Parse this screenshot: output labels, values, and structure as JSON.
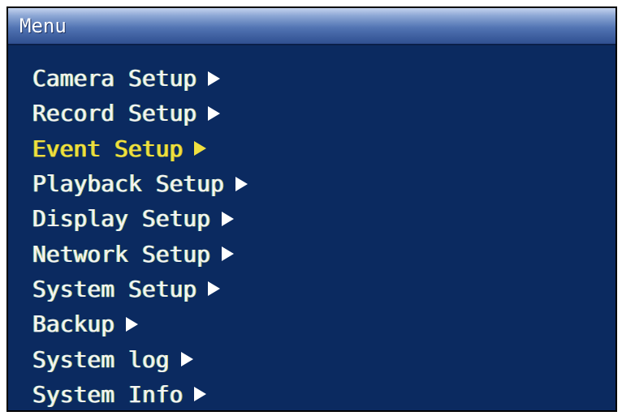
{
  "window": {
    "title": "Menu"
  },
  "menu": {
    "selected_index": 2,
    "items": [
      {
        "label": "Camera Setup"
      },
      {
        "label": "Record Setup"
      },
      {
        "label": "Event Setup"
      },
      {
        "label": "Playback Setup"
      },
      {
        "label": "Display Setup"
      },
      {
        "label": "Network Setup"
      },
      {
        "label": "System Setup"
      },
      {
        "label": "Backup"
      },
      {
        "label": "System log"
      },
      {
        "label": "System Info"
      }
    ]
  },
  "colors": {
    "background": "#0b2a60",
    "text": "#f4f4f4",
    "selected_text": "#f0e040",
    "title_bar": "#5274b3"
  },
  "icons": {
    "submenu_arrow": "triangle-right-icon"
  }
}
